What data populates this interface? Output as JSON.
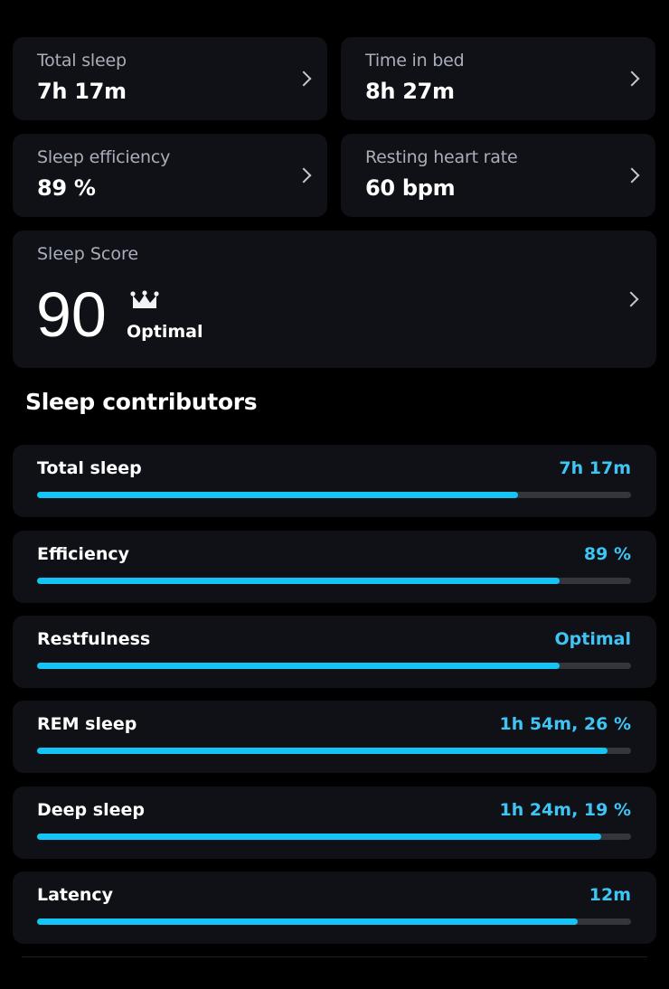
{
  "metrics": [
    {
      "label": "Total sleep",
      "value": "7h 17m"
    },
    {
      "label": "Time in bed",
      "value": "8h 27m"
    },
    {
      "label": "Sleep efficiency",
      "value": "89 %"
    },
    {
      "label": "Resting heart rate",
      "value": "60 bpm"
    }
  ],
  "sleep_score": {
    "label": "Sleep Score",
    "value": "90",
    "rating": "Optimal",
    "rating_icon": "crown-icon"
  },
  "contributors_title": "Sleep contributors",
  "contributors": [
    {
      "name": "Total sleep",
      "value": "7h 17m",
      "progress": 0.81
    },
    {
      "name": "Efficiency",
      "value": "89 %",
      "progress": 0.88
    },
    {
      "name": "Restfulness",
      "value": "Optimal",
      "progress": 0.88
    },
    {
      "name": "REM sleep",
      "value": "1h 54m, 26 %",
      "progress": 0.96
    },
    {
      "name": "Deep sleep",
      "value": "1h 24m, 19 %",
      "progress": 0.95
    },
    {
      "name": "Latency",
      "value": "12m",
      "progress": 0.91
    }
  ],
  "colors": {
    "accent": "#13c4f5",
    "accent_text": "#3ec5f5",
    "card_bg": "#101116",
    "track": "#34363d",
    "muted_text": "#a9aebb"
  }
}
